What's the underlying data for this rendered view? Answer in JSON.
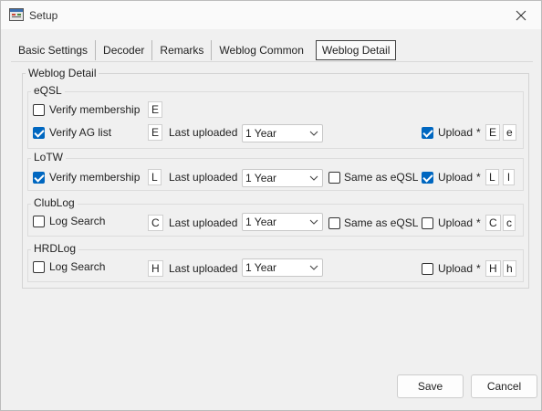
{
  "window": {
    "title": "Setup"
  },
  "tabs": [
    {
      "label": "Basic Settings"
    },
    {
      "label": "Decoder"
    },
    {
      "label": "Remarks"
    },
    {
      "label": "Weblog Common"
    },
    {
      "label": "Weblog Detail",
      "active": true
    }
  ],
  "main": {
    "group_title": "Weblog Detail"
  },
  "eqsl": {
    "title": "eQSL",
    "verify_membership": {
      "label": "Verify membership",
      "checked": false,
      "key": "E"
    },
    "verify_ag": {
      "label": "Verify AG list",
      "checked": true,
      "key": "E"
    },
    "last_uploaded_label": "Last uploaded",
    "last_uploaded_value": "1 Year",
    "upload": {
      "label": "Upload",
      "checked": true,
      "star": "*",
      "key1": "E",
      "key2": "e"
    }
  },
  "lotw": {
    "title": "LoTW",
    "verify_membership": {
      "label": "Verify membership",
      "checked": true,
      "key": "L"
    },
    "last_uploaded_label": "Last uploaded",
    "last_uploaded_value": "1 Year",
    "same_as": {
      "label": "Same as eQSL",
      "checked": false
    },
    "upload": {
      "label": "Upload",
      "checked": true,
      "star": "*",
      "key1": "L",
      "key2": "l"
    }
  },
  "clublog": {
    "title": "ClubLog",
    "log_search": {
      "label": "Log Search",
      "checked": false,
      "key": "C"
    },
    "last_uploaded_label": "Last uploaded",
    "last_uploaded_value": "1 Year",
    "same_as": {
      "label": "Same as eQSL",
      "checked": false
    },
    "upload": {
      "label": "Upload",
      "checked": false,
      "star": "*",
      "key1": "C",
      "key2": "c"
    }
  },
  "hrdlog": {
    "title": "HRDLog",
    "log_search": {
      "label": "Log Search",
      "checked": false,
      "key": "H"
    },
    "last_uploaded_label": "Last uploaded",
    "last_uploaded_value": "1 Year",
    "upload": {
      "label": "Upload",
      "checked": false,
      "star": "*",
      "key1": "H",
      "key2": "h"
    }
  },
  "footer": {
    "save_label": "Save",
    "cancel_label": "Cancel"
  },
  "icons": {
    "app": "app-window-icon",
    "close": "close-icon",
    "dropdown": "chevron-down-icon"
  },
  "colors": {
    "accent": "#0067c0",
    "background": "#f0f0f0"
  }
}
